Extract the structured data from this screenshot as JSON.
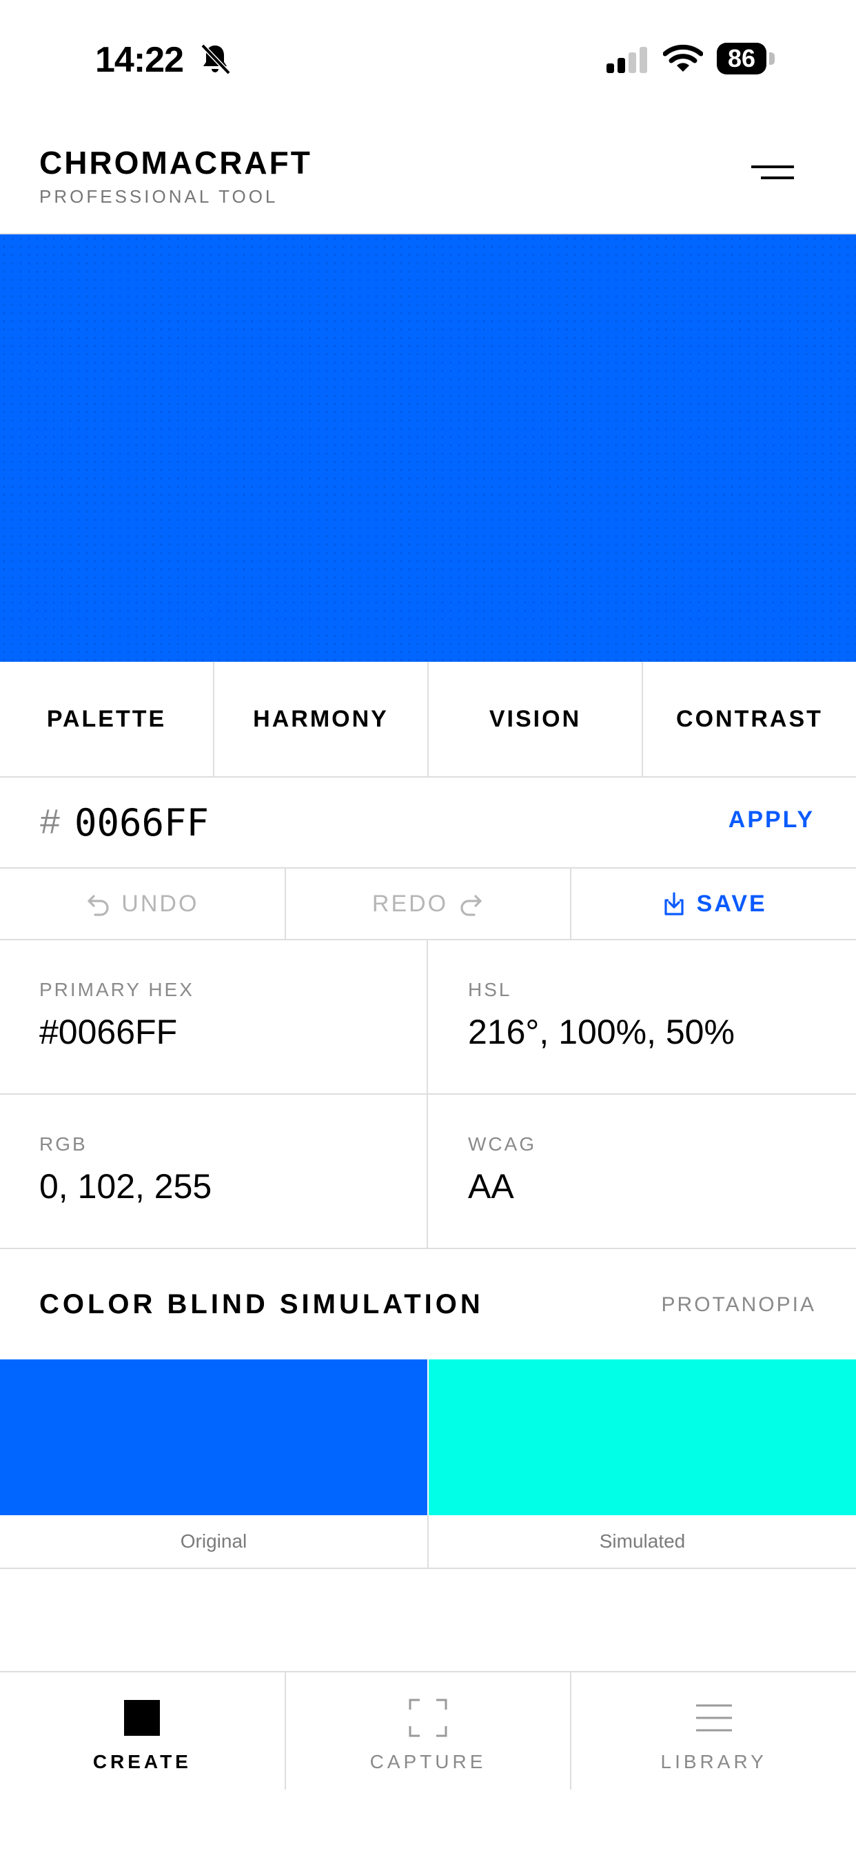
{
  "status_bar": {
    "time": "14:22",
    "battery": "86"
  },
  "header": {
    "title": "CHROMACRAFT",
    "subtitle": "PROFESSIONAL TOOL"
  },
  "canvas": {
    "color": "#0066FF"
  },
  "tabs": [
    {
      "label": "PALETTE"
    },
    {
      "label": "HARMONY"
    },
    {
      "label": "VISION"
    },
    {
      "label": "CONTRAST"
    }
  ],
  "hex_input": {
    "prefix": "#",
    "value": "0066FF",
    "apply_label": "APPLY"
  },
  "actions": {
    "undo": "UNDO",
    "redo": "REDO",
    "save": "SAVE"
  },
  "info": {
    "primary_hex": {
      "label": "PRIMARY HEX",
      "value": "#0066FF"
    },
    "hsl": {
      "label": "HSL",
      "value": "216°, 100%, 50%"
    },
    "rgb": {
      "label": "RGB",
      "value": "0, 102, 255"
    },
    "wcag": {
      "label": "WCAG",
      "value": "AA"
    }
  },
  "color_blind": {
    "title": "COLOR BLIND SIMULATION",
    "mode": "PROTANOPIA",
    "original_label": "Original",
    "simulated_label": "Simulated",
    "original_color": "#0066FF",
    "simulated_color": "#00FFE6"
  },
  "nav": [
    {
      "label": "CREATE",
      "icon": "square-icon",
      "active": true
    },
    {
      "label": "CAPTURE",
      "icon": "capture-frame-icon",
      "active": false
    },
    {
      "label": "LIBRARY",
      "icon": "menu-lines-icon",
      "active": false
    }
  ],
  "colors": {
    "accent": "#0A5BFF",
    "border": "#DEDEDE",
    "muted": "#8A8A8A"
  }
}
